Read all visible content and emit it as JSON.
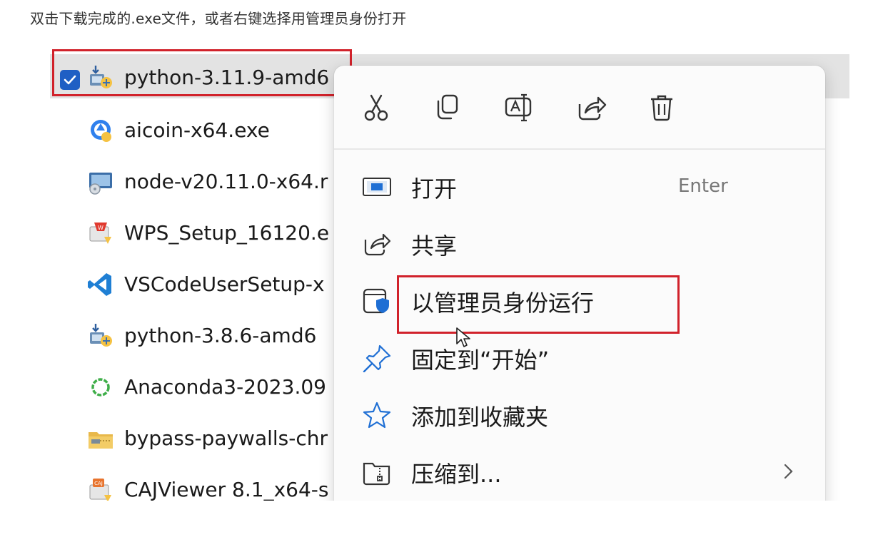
{
  "caption": "双击下载完成的.exe文件，或者右键选择用管理员身份打开",
  "files": [
    {
      "name": "python-3.11.9-amd6",
      "icon": "python-installer-icon",
      "selected": true
    },
    {
      "name": "aicoin-x64.exe",
      "icon": "aicoin-icon"
    },
    {
      "name": "node-v20.11.0-x64.r",
      "icon": "node-installer-icon"
    },
    {
      "name": "WPS_Setup_16120.e",
      "icon": "wps-icon"
    },
    {
      "name": "VSCodeUserSetup-x",
      "icon": "vscode-icon"
    },
    {
      "name": "python-3.8.6-amd6",
      "icon": "python-installer-icon"
    },
    {
      "name": "Anaconda3-2023.09",
      "icon": "anaconda-icon"
    },
    {
      "name": "bypass-paywalls-chr",
      "icon": "archive-icon"
    },
    {
      "name": "CAJViewer 8.1_x64-s",
      "icon": "cajviewer-icon"
    }
  ],
  "toolbar": [
    "cut-icon",
    "copy-icon",
    "rename-icon",
    "share-icon",
    "delete-icon"
  ],
  "menu": [
    {
      "label": "打开",
      "shortcut": "Enter",
      "icon": "open-icon"
    },
    {
      "label": "共享",
      "icon": "share-icon"
    },
    {
      "label": "以管理员身份运行",
      "icon": "admin-shield-icon",
      "highlighted": true
    },
    {
      "label": "固定到“开始”",
      "icon": "pin-icon"
    },
    {
      "label": "添加到收藏夹",
      "icon": "star-icon"
    },
    {
      "label": "压缩到...",
      "icon": "zip-folder-icon",
      "submenu": true
    }
  ],
  "colors": {
    "highlight_border": "#d1222b",
    "accent": "#1f5fc4",
    "selection_band": "#e3e3e3"
  }
}
